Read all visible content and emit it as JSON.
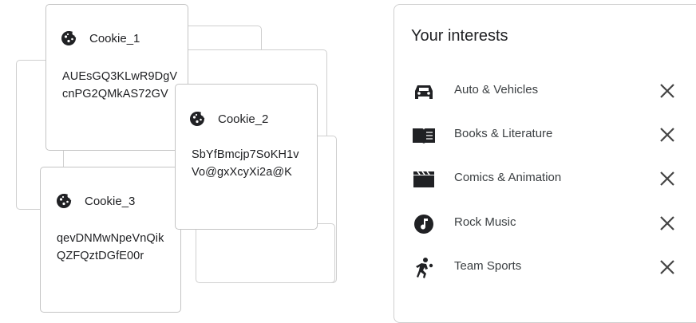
{
  "cookies": [
    {
      "name": "Cookie_1",
      "value_line1": "AUEsGQ3KLwR9DgV",
      "value_line2": "cnPG2QMkAS72GV"
    },
    {
      "name": "Cookie_2",
      "value_line1": "SbYfBmcjp7SoKH1v",
      "value_line2": "Vo@gxXcyXi2a@K"
    },
    {
      "name": "Cookie_3",
      "value_line1": "qevDNMwNpeVnQik",
      "value_line2": "QZFQztDGfE00r"
    }
  ],
  "interests_panel": {
    "title": "Your interests",
    "items": [
      {
        "label": "Auto & Vehicles",
        "icon": "car-icon"
      },
      {
        "label": "Books & Literature",
        "icon": "book-icon"
      },
      {
        "label": "Comics & Animation",
        "icon": "clapperboard-icon"
      },
      {
        "label": "Rock Music",
        "icon": "music-note-icon"
      },
      {
        "label": "Team Sports",
        "icon": "sports-icon"
      }
    ],
    "remove_icon": "close-icon"
  }
}
